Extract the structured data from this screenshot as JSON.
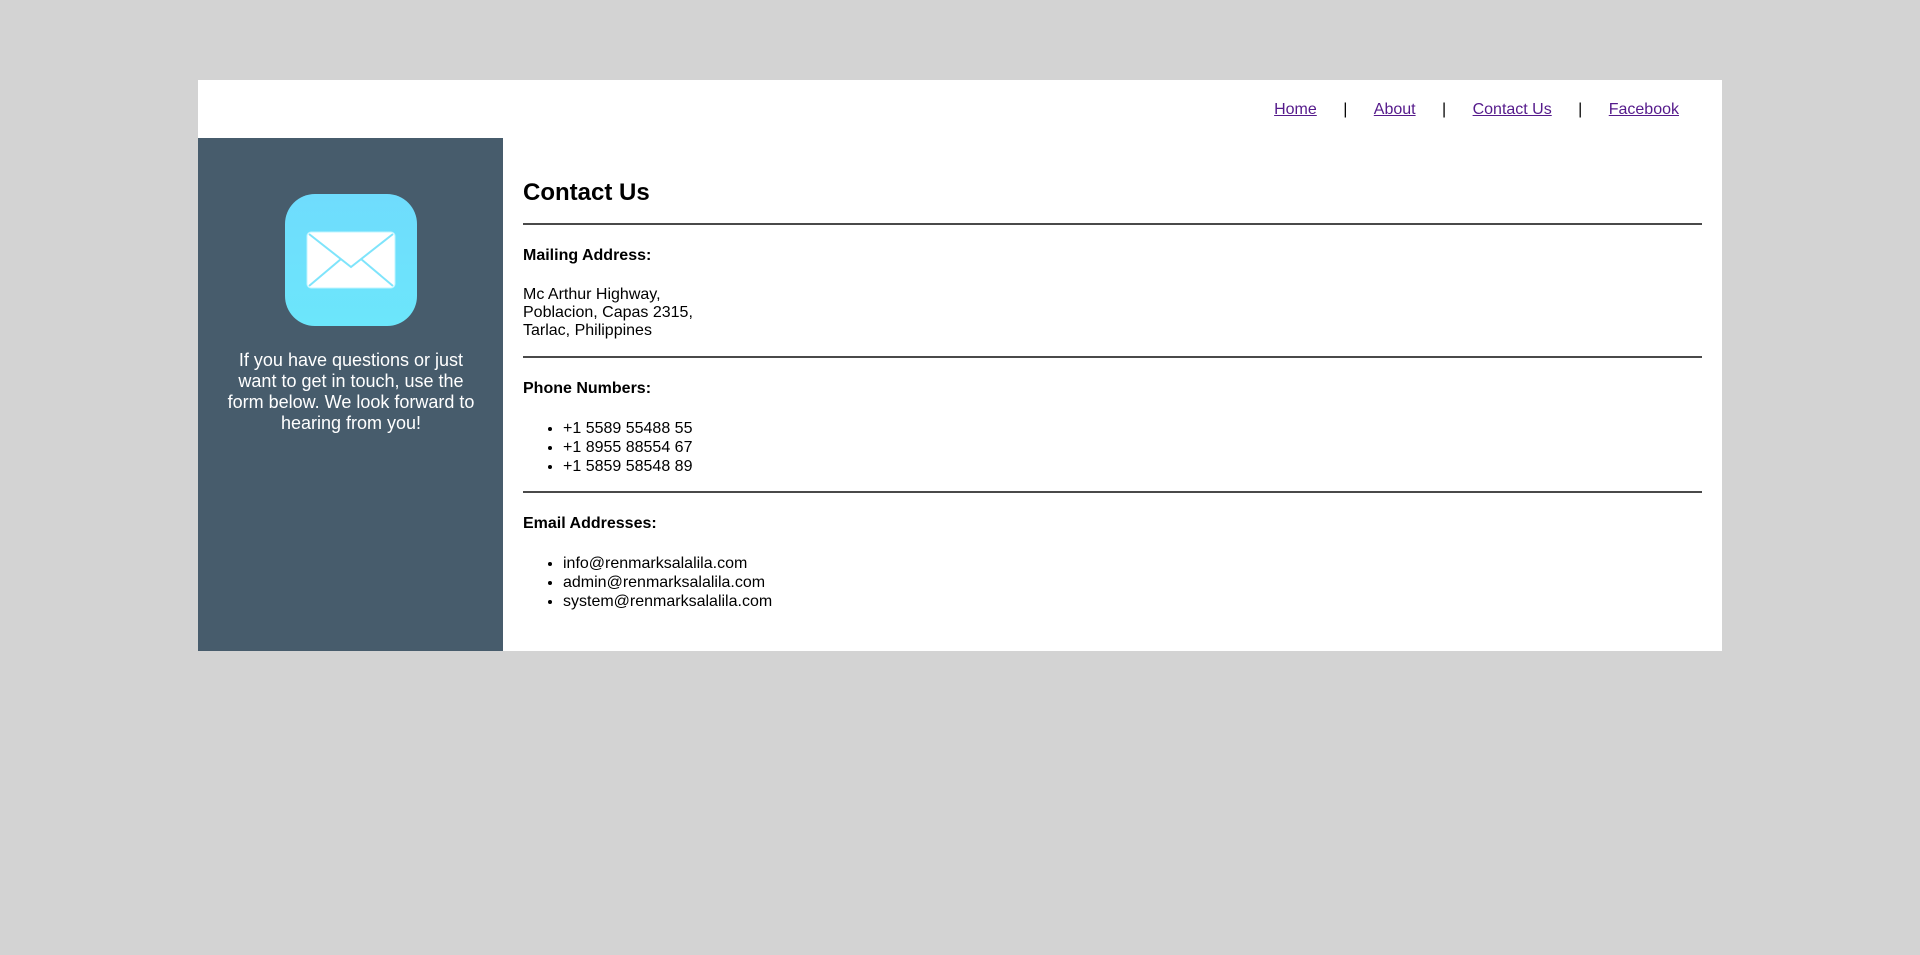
{
  "nav": {
    "home": "Home",
    "about": "About",
    "contact": "Contact Us",
    "facebook": "Facebook",
    "separator": "|"
  },
  "sidebar": {
    "icon": "mail-icon",
    "text": "If you have questions or just want to get in touch, use the form below. We look forward to hearing from you!"
  },
  "main": {
    "title": "Contact Us",
    "mailing": {
      "title": "Mailing Address:",
      "lines": [
        "Mc Arthur Highway,",
        "Poblacion, Capas 2315,",
        "Tarlac, Philippines"
      ]
    },
    "phones": {
      "title": "Phone Numbers:",
      "items": [
        "+1 5589 55488 55",
        "+1 8955 88554 67",
        "+1 5859 58548 89"
      ]
    },
    "emails": {
      "title": "Email Addresses:",
      "items": [
        "info@renmarksalalila.com",
        "admin@renmarksalalila.com",
        "system@renmarksalalila.com"
      ]
    }
  },
  "colors": {
    "page_bg": "#d3d3d3",
    "sidebar_bg": "#475c6c",
    "icon_bg": "#6ce6fb",
    "link": "#551a8b"
  }
}
